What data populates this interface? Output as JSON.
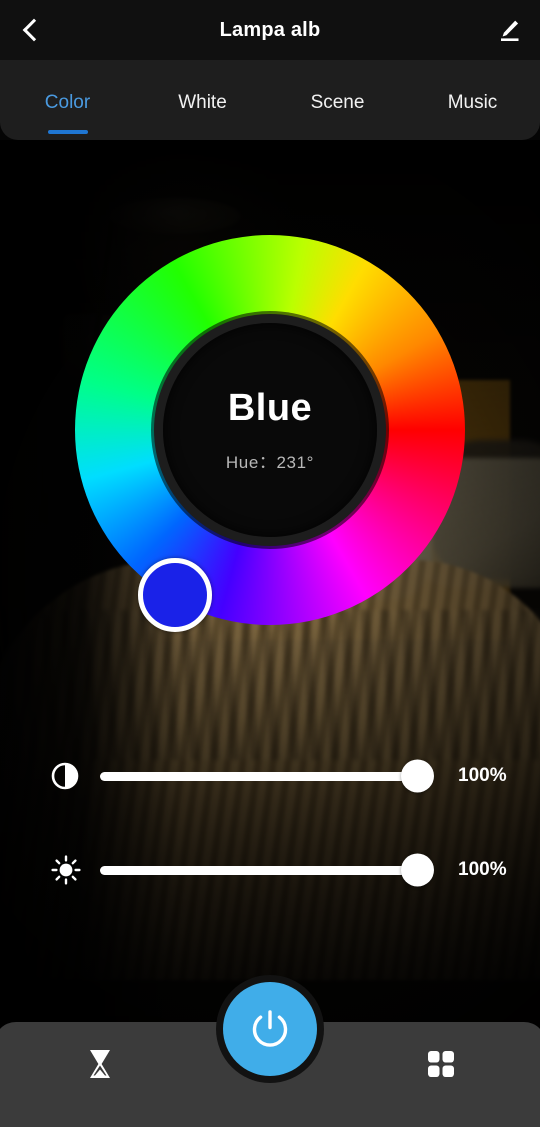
{
  "header": {
    "title": "Lampa alb",
    "back_icon": "chevron-left-icon",
    "edit_icon": "pencil-edit-icon"
  },
  "tabs": [
    {
      "label": "Color",
      "active": true
    },
    {
      "label": "White",
      "active": false
    },
    {
      "label": "Scene",
      "active": false
    },
    {
      "label": "Music",
      "active": false
    }
  ],
  "color_picker": {
    "color_name": "Blue",
    "hue_label": "Hue：231°",
    "hue_degrees": 231,
    "handle_color": "#1a22e8",
    "accent_color": "#4a9ae0"
  },
  "sliders": [
    {
      "icon": "saturation-contrast-icon",
      "value_label": "100%",
      "value": 100
    },
    {
      "icon": "brightness-sun-icon",
      "value_label": "100%",
      "value": 100
    }
  ],
  "bottom_bar": {
    "timer_icon": "hourglass-timer-icon",
    "power_icon": "power-icon",
    "power_color": "#40ade9",
    "more_icon": "grid-apps-icon"
  }
}
